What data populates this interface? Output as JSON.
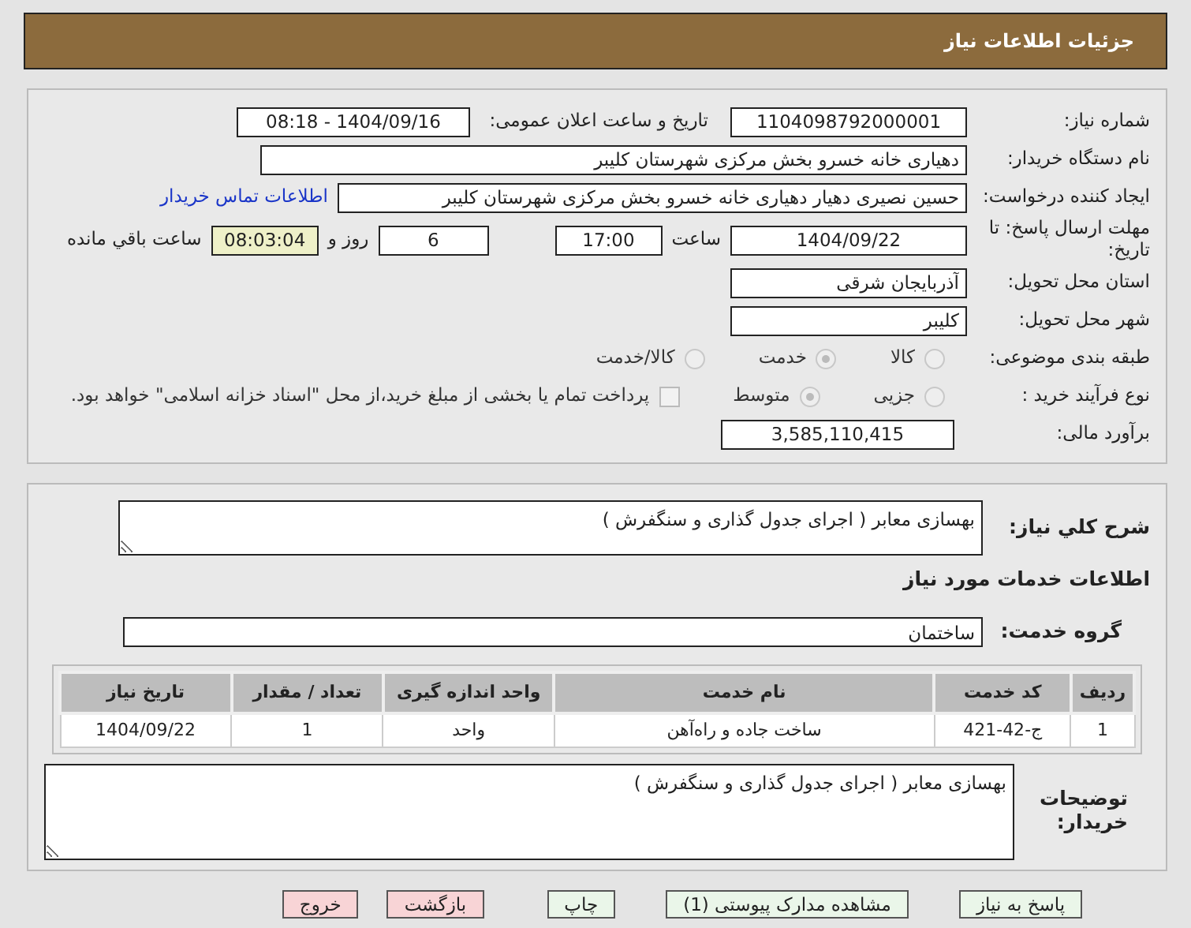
{
  "title": "جزئیات اطلاعات نیاز",
  "need_number": {
    "label": "شماره نیاز:",
    "value": "1104098792000001"
  },
  "announce": {
    "label": "تاریخ و ساعت اعلان عمومی:",
    "value": "1404/09/16 - 08:18"
  },
  "buyer": {
    "label": "نام دستگاه خریدار:",
    "value": "دهیاری خانه خسرو بخش مرکزی شهرستان کلیبر"
  },
  "creator": {
    "label": "ایجاد کننده درخواست:",
    "value": "حسین نصیری دهیار دهیاری خانه خسرو بخش مرکزی شهرستان کلیبر",
    "link": "اطلاعات تماس خریدار"
  },
  "deadline": {
    "label": "مهلت ارسال پاسخ: تا تاریخ:",
    "date": "1404/09/22",
    "time_label": "ساعت",
    "time": "17:00",
    "days": "6",
    "days_label": "روز و",
    "remaining": "08:03:04",
    "remaining_label": "ساعت باقي مانده"
  },
  "province": {
    "label": "استان محل تحویل:",
    "value": "آذربایجان شرقی"
  },
  "city": {
    "label": "شهر محل تحویل:",
    "value": "کلیبر"
  },
  "category": {
    "label": "طبقه بندی موضوعی:",
    "options": [
      {
        "label": "کالا",
        "selected": false
      },
      {
        "label": "خدمت",
        "selected": true
      },
      {
        "label": "کالا/خدمت",
        "selected": false
      }
    ]
  },
  "purchase": {
    "label": "نوع فرآیند خرید :",
    "options": [
      {
        "label": "جزیی",
        "selected": false
      },
      {
        "label": "متوسط",
        "selected": true
      }
    ],
    "checkbox": {
      "label": "پرداخت تمام یا بخشی از مبلغ خرید،از محل \"اسناد خزانه اسلامی\" خواهد بود.",
      "checked": false
    }
  },
  "estimate": {
    "label": "برآورد مالی:",
    "value": "3,585,110,415"
  },
  "description": {
    "label": "شرح کلي نیاز:",
    "value": "بهسازی معابر ( اجرای جدول گذاری و سنگفرش )"
  },
  "services_heading": "اطلاعات خدمات مورد نیاز",
  "service_group": {
    "label": "گروه خدمت:",
    "value": "ساختمان"
  },
  "table": {
    "columns": [
      "ردیف",
      "کد خدمت",
      "نام خدمت",
      "واحد اندازه گیری",
      "تعداد / مقدار",
      "تاریخ نیاز"
    ],
    "rows": [
      [
        "1",
        "ج-42-421",
        "ساخت جاده و راه‌آهن",
        "واحد",
        "1",
        "1404/09/22"
      ]
    ]
  },
  "buyer_notes": {
    "label": "توضیحات خریدار:",
    "value": "بهسازی معابر ( اجرای جدول گذاری و سنگفرش )"
  },
  "buttons": [
    {
      "label": "پاسخ به نیاز",
      "kind": "normal"
    },
    {
      "label": "مشاهده مدارک پیوستی (1)",
      "kind": "normal"
    },
    {
      "label": "چاپ",
      "kind": "normal"
    },
    {
      "label": "بازگشت",
      "kind": "danger"
    },
    {
      "label": "خروج",
      "kind": "danger"
    }
  ]
}
